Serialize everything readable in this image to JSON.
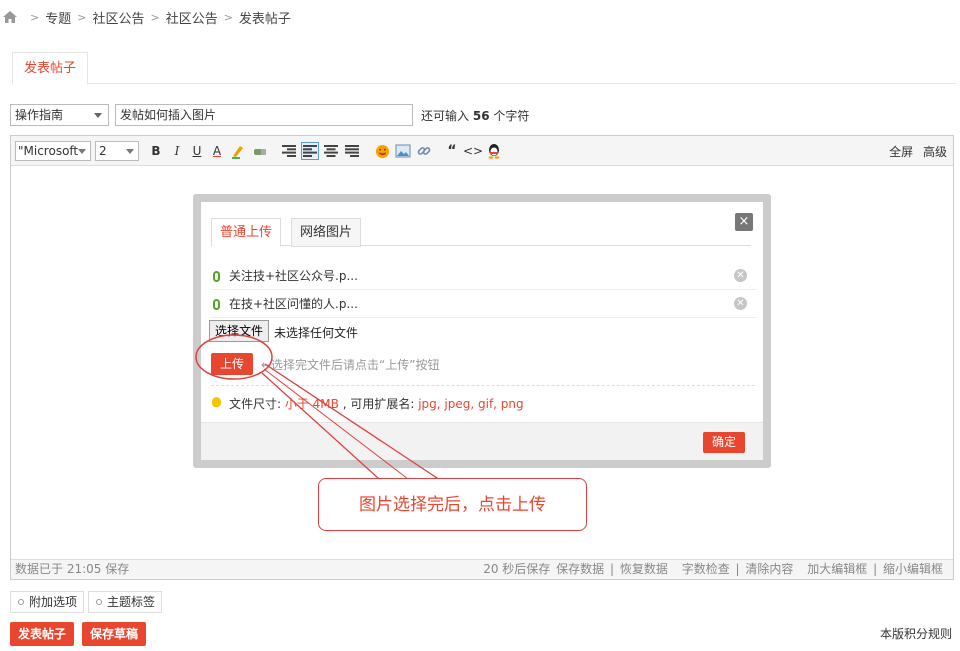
{
  "breadcrumb": [
    "专题",
    "社区公告",
    "社区公告",
    "发表帖子"
  ],
  "tab": {
    "label": "发表帖子"
  },
  "title_row": {
    "type_value": "操作指南",
    "title_value": "发帖如何插入图片",
    "remain_prefix": "还可输入",
    "remain_count": "56",
    "remain_suffix": "个字符"
  },
  "toolbar": {
    "font_value": "\"Microsoft",
    "size_value": "2",
    "bold": "B",
    "italic": "I",
    "underline": "U",
    "font_color": "A",
    "quote": "“",
    "code": "<>",
    "fullscreen": "全屏",
    "advanced": "高级"
  },
  "status": {
    "left": "数据已于 21:05 保存",
    "autosave": "20 秒后保存",
    "save_data": "保存数据",
    "restore_data": "恢复数据",
    "word_check": "字数检查",
    "clear_content": "清除内容",
    "enlarge": "加大编辑框",
    "shrink": "缩小编辑框",
    "sep": "|"
  },
  "dialog": {
    "tab_normal": "普通上传",
    "tab_web": "网络图片",
    "close": "×",
    "files": [
      "关注技+社区公众号.p...",
      "在技+社区问懂的人.p..."
    ],
    "choose_file": "选择文件",
    "no_file": "未选择任何文件",
    "upload": "上传",
    "upload_hint": "←选择完文件后请点击“上传”按钮",
    "size_label": "文件尺寸: ",
    "size_value": "小于 4MB",
    "ext_label": " , 可用扩展名: ",
    "ext_value": "jpg, jpeg, gif, png",
    "confirm": "确定"
  },
  "callout": {
    "text": "图片选择完后，点击上传"
  },
  "bottom": {
    "extra_options": "附加选项",
    "topic_tags": "主题标签",
    "post_button": "发表帖子",
    "save_draft": "保存草稿",
    "rules": "本版积分规则"
  },
  "colors": {
    "accent": "#e8462f",
    "annotation": "#e04040"
  }
}
